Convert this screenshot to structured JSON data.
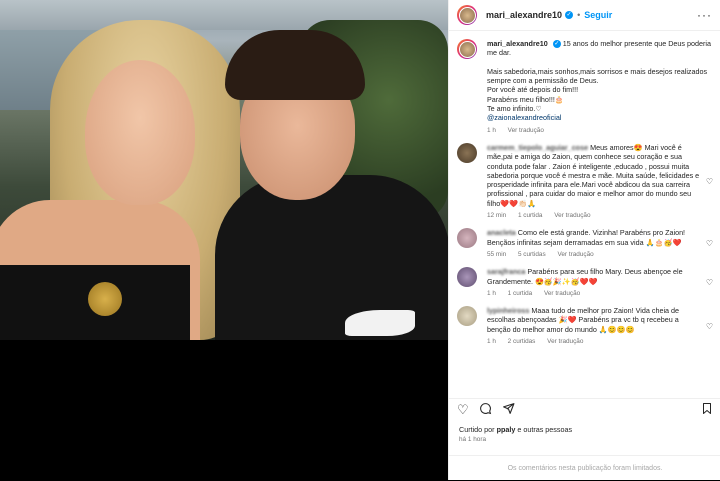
{
  "post": {
    "author": "mari_alexandre10",
    "follow_label": "Seguir",
    "caption_text": "15 anos do melhor presente que Deus poderia me dar.\n\nMais sabedoria,mais sonhos,mais sorrisos e mais desejos realizados sempre com a permissão de Deus.\nPor você até depois do fim!!!\nParabéns meu filho!!!🎂\nTe amo infinito.♡",
    "caption_mention": "@zaionalexandreoficial",
    "caption_time": "1 h",
    "see_translation": "Ver tradução"
  },
  "comments": [
    {
      "user": "carmem_tiepolo_aguiar_cose",
      "text": "Meus amores😍 Mari você é mãe,pai e amiga do Zaion, quem conhece seu coração e sua conduta pode falar . Zaion é inteligente ,educado , possui muita sabedoria porque você é mestra e mãe. Muita saúde, felicidades e prosperidade infinita para ele.Mari você abdicou da sua carreira profissional , para cuidar do maior e melhor amor do mundo seu filho❤️❤️👏🏻🙏",
      "time": "12 min",
      "likes": "1 curtida",
      "translation": "Ver tradução",
      "color": "#6e5a3f"
    },
    {
      "user": "anacleta",
      "text": "Como ele está grande. Vizinha! Parabéns pro Zaion! Bençãos infinitas sejam derramadas em sua vida 🙏🎂🥳❤️",
      "time": "55 min",
      "likes": "5 curtidas",
      "translation": "Ver tradução",
      "color": "#b79aa3"
    },
    {
      "user": "sarajfranca",
      "text": "Parabéns para seu filho Mary. Deus abençoe ele Grandemente. 😍🥳🎉✨🥳❤️❤️",
      "time": "1 h",
      "likes": "1 curtida",
      "translation": "Ver tradução",
      "color": "#8f7a9e"
    },
    {
      "user": "lypinheiross",
      "text": "Maaa tudo de melhor pro Zaion! Vida cheia de escolhas abençoadas 🎉❤️ Parabéns pra vc tb q recebeu a benção do melhor amor do mundo 🙏😊😊😊",
      "time": "1 h",
      "likes": "2 curtidas",
      "translation": "Ver tradução",
      "color": "#c9c0a8"
    }
  ],
  "liked_by": {
    "prefix": "Curtido por",
    "user": "ppaly",
    "suffix": "e outras pessoas"
  },
  "post_time": "há 1 hora",
  "comments_limited": "Os comentários nesta publicação foram limitados.",
  "icons": {
    "heart": "heart-icon",
    "comment": "comment-icon",
    "share": "share-icon",
    "bookmark": "bookmark-icon",
    "more": "more-icon"
  },
  "colors": {
    "link": "#0095f6",
    "mention": "#00376b",
    "muted": "#737373"
  }
}
